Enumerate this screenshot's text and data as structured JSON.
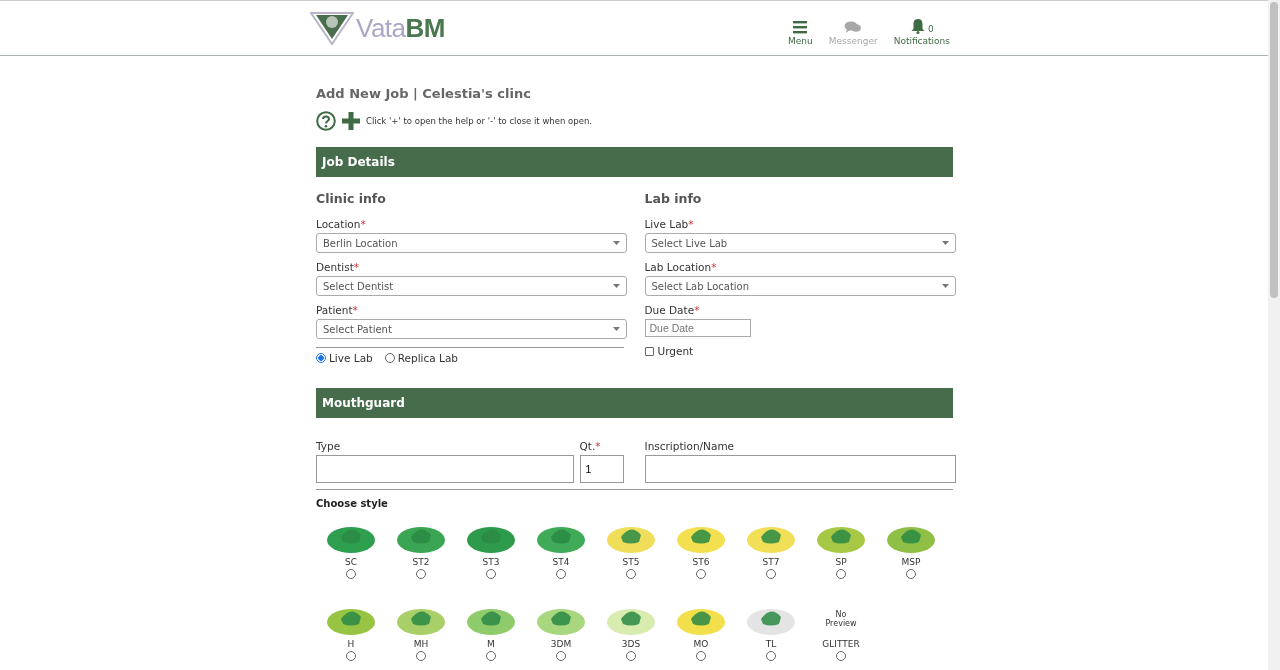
{
  "header": {
    "logo": {
      "text_light": "Vata",
      "text_bold": "BM"
    },
    "nav": [
      {
        "kind": "menu",
        "label": "Menu",
        "disabled": false
      },
      {
        "kind": "chat",
        "label": "Messenger",
        "disabled": true
      },
      {
        "kind": "bell",
        "label": "Notifications",
        "count": "0",
        "disabled": false
      }
    ]
  },
  "page_title": "Add New Job | Celestia's clinc",
  "help_text": "Click '+' to open the help or '-' to close it when open.",
  "job_details": {
    "title": "Job Details",
    "clinic_info": {
      "heading": "Clinic info",
      "fields": [
        {
          "label": "Location",
          "required_mark": "*",
          "value": "Berlin Location"
        },
        {
          "label": "Dentist",
          "required_mark": "*",
          "value": "Select Dentist"
        },
        {
          "label": "Patient",
          "required_mark": "*",
          "value": "Select Patient"
        }
      ],
      "lab_type": [
        {
          "label": "Live Lab",
          "selected": true
        },
        {
          "label": "Replica Lab",
          "selected": false
        }
      ]
    },
    "lab_info": {
      "heading": "Lab info",
      "fields": [
        {
          "label": "Live Lab",
          "required_mark": "*",
          "value": "Select Live Lab"
        },
        {
          "label": "Lab Location",
          "required_mark": "*",
          "value": "Select Lab Location"
        }
      ],
      "due_date": {
        "label": "Due Date",
        "required_mark": "*",
        "placeholder": "Due Date"
      },
      "urgent": {
        "label": "Urgent",
        "checked": false
      }
    }
  },
  "mouthguard": {
    "title": "Mouthguard",
    "type": {
      "label": "Type"
    },
    "quantity": {
      "label": "Qt.",
      "required_mark": "*",
      "value": "1"
    },
    "inscription": {
      "label": "Inscription/Name"
    },
    "choose_style_label": "Choose style",
    "styles": [
      {
        "label": "SC",
        "color": "#2e9e4f",
        "selected": false
      },
      {
        "label": "ST2",
        "color": "#3aa552",
        "selected": false
      },
      {
        "label": "ST3",
        "color": "#2e9a4c",
        "selected": false
      },
      {
        "label": "ST4",
        "color": "#3fab58",
        "selected": false
      },
      {
        "label": "ST5",
        "color": "#f0de5a",
        "selected": false
      },
      {
        "label": "ST6",
        "color": "#f2e04e",
        "selected": false
      },
      {
        "label": "ST7",
        "color": "#f2df58",
        "selected": false
      },
      {
        "label": "SP",
        "color": "#a7c845",
        "selected": false
      },
      {
        "label": "MSP",
        "color": "#8fbf45",
        "selected": false
      },
      {
        "label": "H",
        "color": "#98c443",
        "selected": false
      },
      {
        "label": "MH",
        "color": "#a9d068",
        "selected": false
      },
      {
        "label": "M",
        "color": "#8fcb6a",
        "selected": false
      },
      {
        "label": "3DM",
        "color": "#a8d77f",
        "selected": false
      },
      {
        "label": "3DS",
        "color": "#d8ecb0",
        "selected": false
      },
      {
        "label": "MO",
        "color": "#f2df4c",
        "selected": false
      },
      {
        "label": "TL",
        "color": "#e4e4e4",
        "selected": false
      },
      {
        "label": "GLITTER",
        "preview_text": "No Preview",
        "selected": false
      }
    ]
  }
}
